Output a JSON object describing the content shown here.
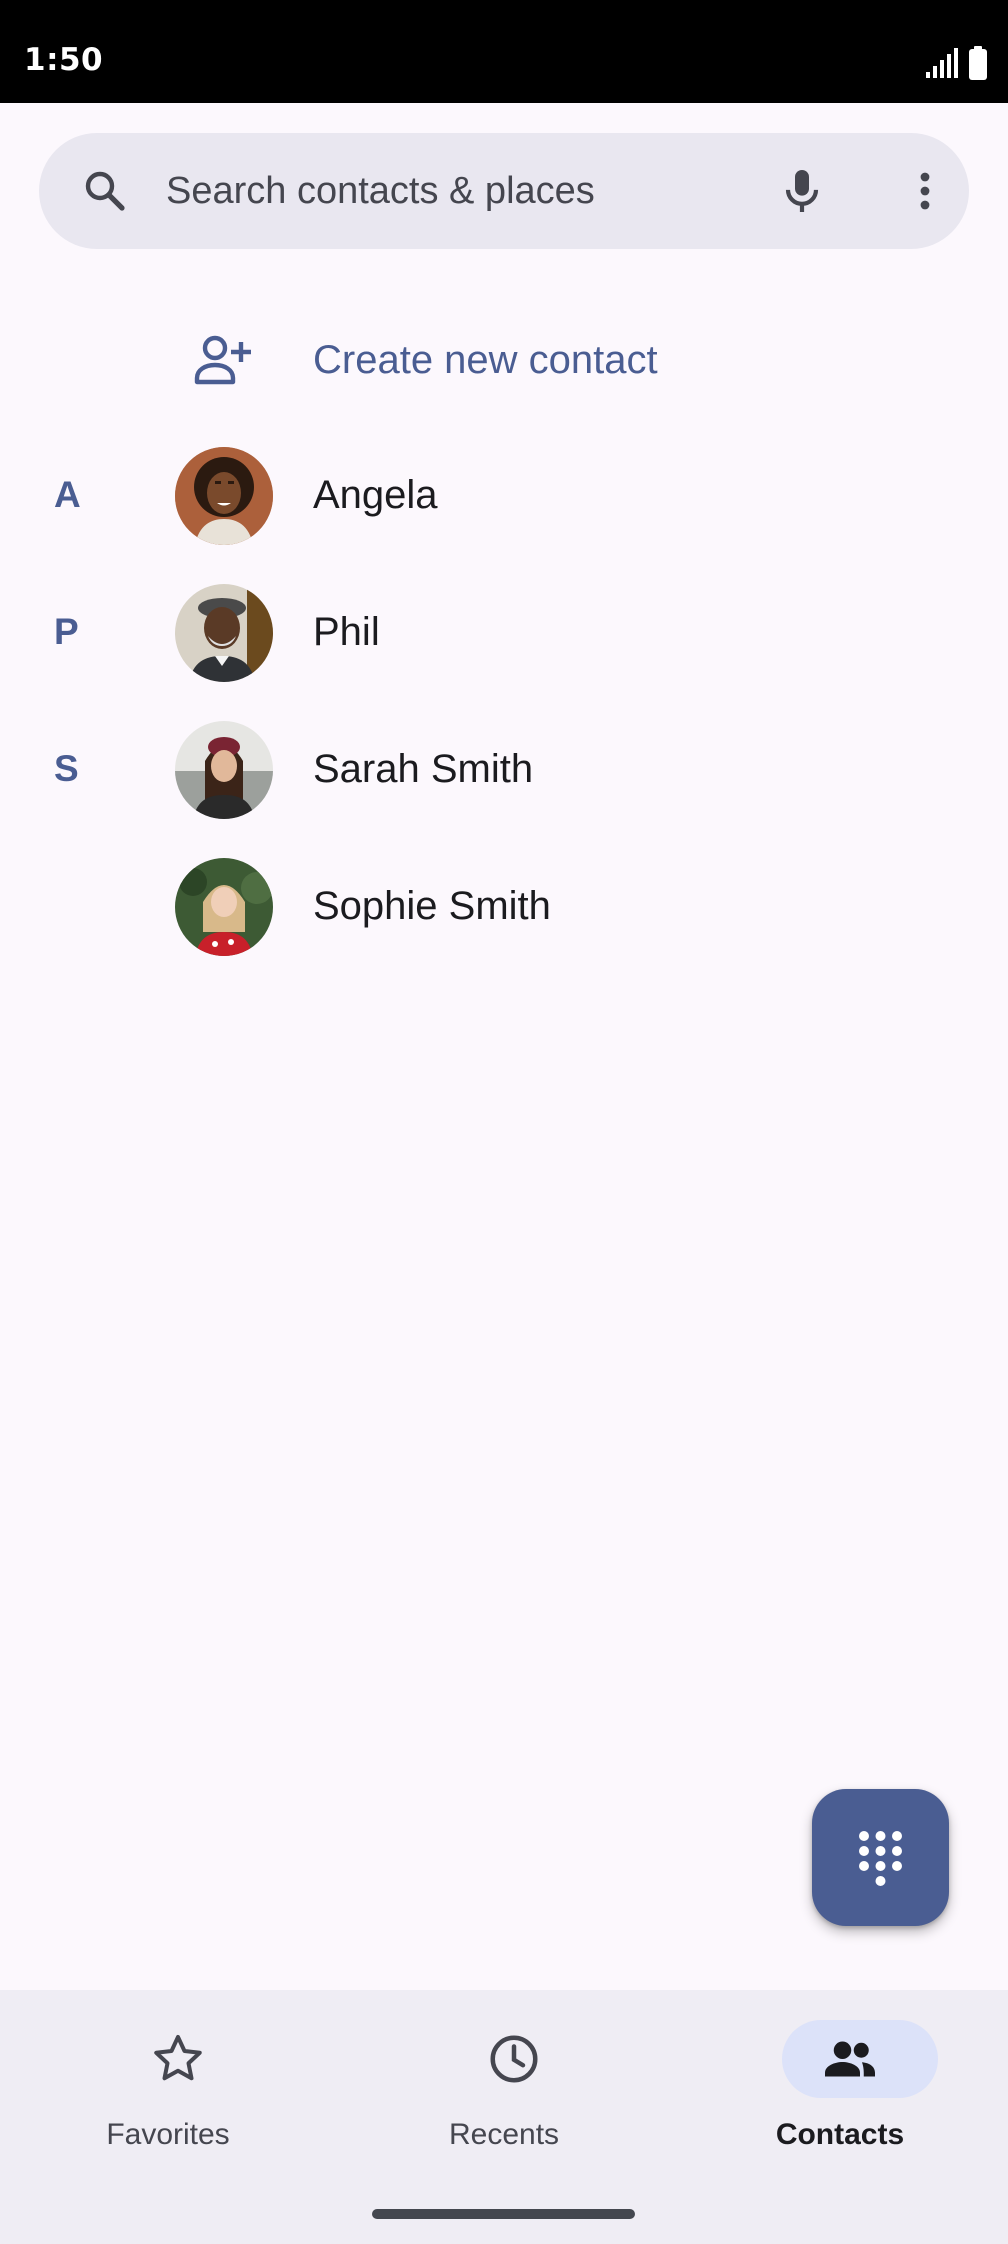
{
  "status_bar": {
    "time": "1:50"
  },
  "search": {
    "placeholder": "Search contacts & places"
  },
  "create_contact": {
    "label": "Create new contact"
  },
  "contacts": [
    {
      "letter": "A",
      "name": "Angela"
    },
    {
      "letter": "P",
      "name": "Phil"
    },
    {
      "letter": "S",
      "name": "Sarah Smith"
    },
    {
      "letter": "",
      "name": "Sophie Smith"
    }
  ],
  "bottom_nav": {
    "items": [
      {
        "label": "Favorites",
        "icon": "star-icon",
        "active": false
      },
      {
        "label": "Recents",
        "icon": "clock-icon",
        "active": false
      },
      {
        "label": "Contacts",
        "icon": "people-icon",
        "active": true
      }
    ]
  },
  "colors": {
    "accent": "#4a5d92",
    "background": "#fcf8fd",
    "nav_background": "#efedf4",
    "active_pill": "#dce2f9"
  }
}
